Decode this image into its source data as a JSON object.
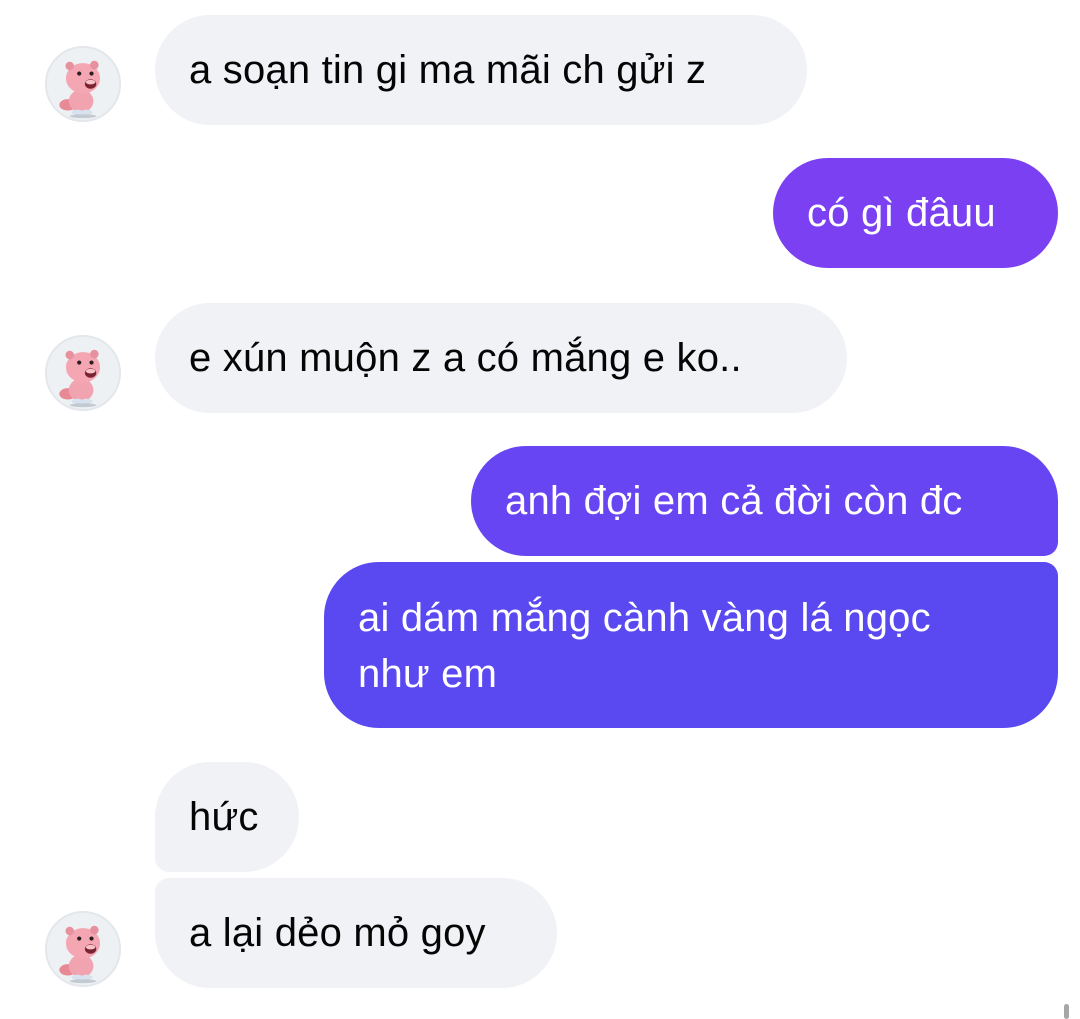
{
  "colors": {
    "incoming_bubble": "#f0f2f5",
    "outgoing_gradient_top": "#7b3ff2",
    "outgoing_gradient_bottom": "#5848f0",
    "text_dark": "#050505",
    "text_light": "#ffffff"
  },
  "avatar": {
    "icon": "pink-beaver-icon"
  },
  "messages": [
    {
      "sender": "other",
      "text": "a soạn tin gi ma mãi ch gửi z"
    },
    {
      "sender": "me",
      "text": "có gì đâuu"
    },
    {
      "sender": "other",
      "text": "e xún muộn z a có mắng e ko.."
    },
    {
      "sender": "me",
      "text": "anh đợi em cả đời còn đc"
    },
    {
      "sender": "me",
      "lines": [
        "ai dám mắng cành vàng lá ngọc",
        "như em"
      ]
    },
    {
      "sender": "other",
      "text": "hức"
    },
    {
      "sender": "other",
      "text": "a lại dẻo mỏ goy"
    }
  ]
}
